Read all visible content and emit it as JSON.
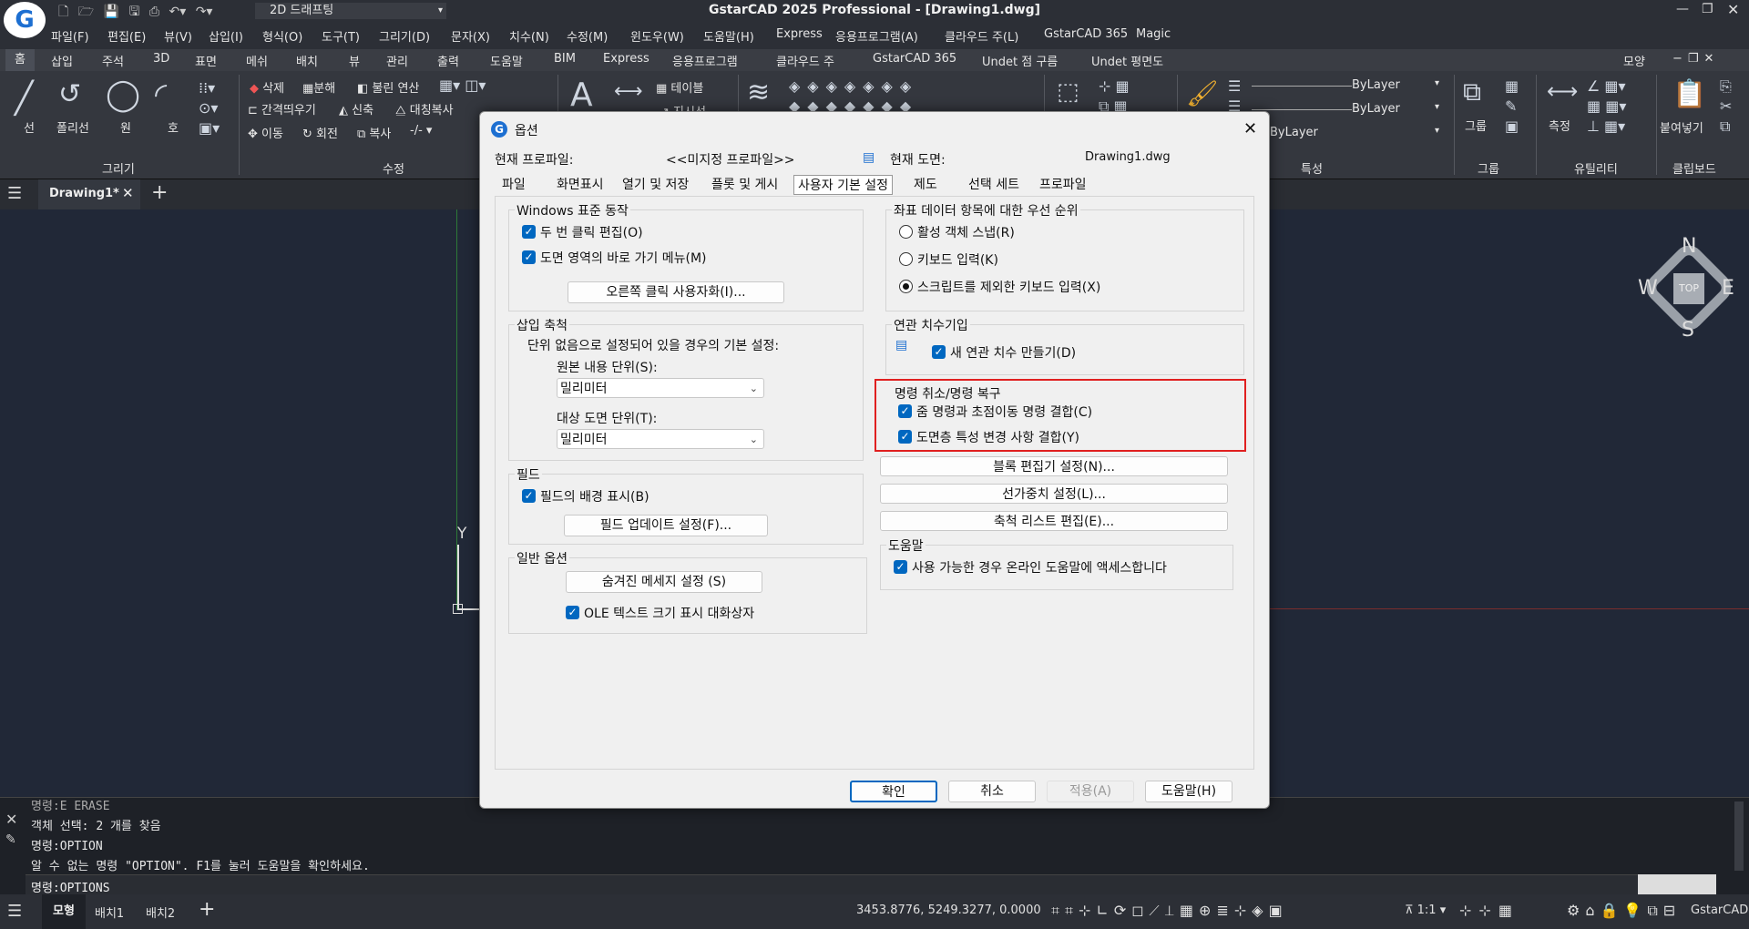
{
  "app": {
    "title": "GstarCAD 2025 Professional - [Drawing1.dwg]",
    "workspace": "2D 드래프팅"
  },
  "menu": [
    "파일(F)",
    "편집(E)",
    "뷰(V)",
    "삽입(I)",
    "형식(O)",
    "도구(T)",
    "그리기(D)",
    "문자(X)",
    "치수(N)",
    "수정(M)",
    "윈도우(W)",
    "도움말(H)",
    "Express",
    "응용프로그램(A)",
    "클라우드 주(L)",
    "GstarCAD 365",
    "Magic"
  ],
  "ribbon_tabs": [
    "홈",
    "삽입",
    "주석",
    "3D",
    "표면",
    "메쉬",
    "배치",
    "뷰",
    "관리",
    "출력",
    "도움말",
    "BIM",
    "Express",
    "응용프로그램",
    "클라우드 주",
    "GstarCAD 365",
    "Undet 점 구름",
    "Undet 평면도"
  ],
  "ribbon_right": "모양",
  "ribbon": {
    "draw": {
      "line": "선",
      "polyline": "폴리선",
      "circle": "원",
      "arc": "호",
      "panel": "그리기"
    },
    "modify": {
      "delete": "삭제",
      "explode": "분해",
      "lengthen": "불린 연산",
      "offset": "간격띄우기",
      "stretch": "신축",
      "mirror": "대칭복사",
      "move": "이동",
      "rotate": "회전",
      "copy": "복사",
      "panel": "수정"
    },
    "annot": {
      "table": "테이블",
      "leader": "지시선"
    },
    "props": {
      "bylayer1": "ByLayer",
      "bylayer2": "ByLayer",
      "bylayer3": "ByLayer",
      "panel": "특성"
    },
    "group": {
      "label": "그룹",
      "panel": "그룹"
    },
    "util": {
      "measure": "측정",
      "panel": "유틸리티"
    },
    "clip": {
      "paste": "붙여넣기",
      "panel": "클립보드"
    }
  },
  "doc_tab": "Drawing1*",
  "compass": {
    "n": "N",
    "s": "S",
    "e": "E",
    "w": "W",
    "top": "TOP"
  },
  "ucs": {
    "y": "Y"
  },
  "dialog": {
    "title": "옵션",
    "profile_label": "현재 프로파일:",
    "profile_value": "<<미지정 프로파일>>",
    "drawing_label": "현재 도면:",
    "drawing_value": "Drawing1.dwg",
    "tabs": [
      "파일",
      "화면표시",
      "열기 및 저장",
      "플롯 및 게시",
      "사용자 기본 설정",
      "제도",
      "선택 세트",
      "프로파일"
    ],
    "windows_group": "Windows 표준 동작",
    "dblclick": "두 번 클릭 편집(O)",
    "shortcut_menu": "도면 영역의 바로 가기 메뉴(M)",
    "rightclick_btn": "오른쪽 클릭 사용자화(I)...",
    "insert_group": "삽입 축척",
    "insert_desc": "단위 없음으로 설정되어 있을 경우의 기본 설정:",
    "source_units_label": "원본 내용 단위(S):",
    "source_units": "밀리미터",
    "target_units_label": "대상 도면 단위(T):",
    "target_units": "밀리미터",
    "fields_group": "필드",
    "field_bg": "필드의 배경 표시(B)",
    "field_update_btn": "필드 업데이트 설정(F)...",
    "general_group": "일반 옵션",
    "hidden_msg_btn": "숨겨진 메세지 설정 (S)",
    "ole_text": "OLE 텍스트 크기 표시 대화상자",
    "coord_group": "좌표 데이터 항목에 대한 우선 순위",
    "radio1": "활성 객체 스냅(R)",
    "radio2": "키보드 입력(K)",
    "radio3": "스크립트를 제외한 키보드 입력(X)",
    "assoc_group": "연관 치수기입",
    "assoc_new": "새 연관 치수 만들기(D)",
    "undo_group": "명령 취소/명령 복구",
    "undo_zoom": "줌 명령과 초점이동 명령 결합(C)",
    "undo_layer": "도면층 특성 변경 사항 결합(Y)",
    "block_btn": "블록 편집기 설정(N)...",
    "lineweight_btn": "선가중치 설정(L)...",
    "scale_btn": "축척 리스트 편집(E)...",
    "help_group": "도움말",
    "online_help": "사용 가능한 경우 온라인 도움말에 액세스합니다",
    "ok": "확인",
    "cancel": "취소",
    "apply": "적용(A)",
    "help": "도움말(H)"
  },
  "command": {
    "lines": [
      "명령:E ERASE",
      "객체 선택: 2 개를 찾음",
      "명령:OPTION",
      "알 수 없는 명령 \"OPTION\".  F1를 눌러 도움말을 확인하세요."
    ],
    "input": "명령:OPTIONS"
  },
  "status": {
    "tabs": [
      "모형",
      "배치1",
      "배치2"
    ],
    "coords": "3453.8776, 5249.3277, 0.0000",
    "scale": "1:1",
    "app": "GstarCAD"
  },
  "colors": {
    "accent": "#0067c0",
    "highlight": "#e02020",
    "canvas": "#212837"
  }
}
